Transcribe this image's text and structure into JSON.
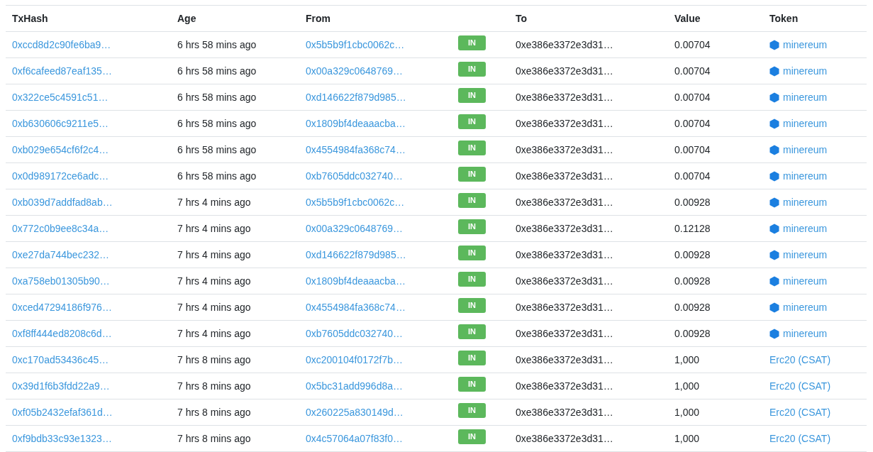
{
  "table": {
    "columns": [
      "TxHash",
      "Age",
      "From",
      "",
      "To",
      "Value",
      "Token"
    ],
    "rows": [
      {
        "txhash": "0xccd8d2c90fe6ba9…",
        "age": "6 hrs 58 mins ago",
        "from": "0x5b5b9f1cbc0062c…",
        "direction": "IN",
        "to": "0xe386e3372e3d31…",
        "value": "0.00704",
        "token": {
          "kind": "icon-link",
          "label": "minereum"
        }
      },
      {
        "txhash": "0xf6cafeed87eaf135…",
        "age": "6 hrs 58 mins ago",
        "from": "0x00a329c0648769…",
        "direction": "IN",
        "to": "0xe386e3372e3d31…",
        "value": "0.00704",
        "token": {
          "kind": "icon-link",
          "label": "minereum"
        }
      },
      {
        "txhash": "0x322ce5c4591c51…",
        "age": "6 hrs 58 mins ago",
        "from": "0xd146622f879d985…",
        "direction": "IN",
        "to": "0xe386e3372e3d31…",
        "value": "0.00704",
        "token": {
          "kind": "icon-link",
          "label": "minereum"
        }
      },
      {
        "txhash": "0xb630606c9211e5…",
        "age": "6 hrs 58 mins ago",
        "from": "0x1809bf4deaaacba…",
        "direction": "IN",
        "to": "0xe386e3372e3d31…",
        "value": "0.00704",
        "token": {
          "kind": "icon-link",
          "label": "minereum"
        }
      },
      {
        "txhash": "0xb029e654cf6f2c4…",
        "age": "6 hrs 58 mins ago",
        "from": "0x4554984fa368c74…",
        "direction": "IN",
        "to": "0xe386e3372e3d31…",
        "value": "0.00704",
        "token": {
          "kind": "icon-link",
          "label": "minereum"
        }
      },
      {
        "txhash": "0x0d989172ce6adc…",
        "age": "6 hrs 58 mins ago",
        "from": "0xb7605ddc032740…",
        "direction": "IN",
        "to": "0xe386e3372e3d31…",
        "value": "0.00704",
        "token": {
          "kind": "icon-link",
          "label": "minereum"
        }
      },
      {
        "txhash": "0xb039d7addfad8ab…",
        "age": "7 hrs 4 mins ago",
        "from": "0x5b5b9f1cbc0062c…",
        "direction": "IN",
        "to": "0xe386e3372e3d31…",
        "value": "0.00928",
        "token": {
          "kind": "icon-link",
          "label": "minereum"
        }
      },
      {
        "txhash": "0x772c0b9ee8c34a…",
        "age": "7 hrs 4 mins ago",
        "from": "0x00a329c0648769…",
        "direction": "IN",
        "to": "0xe386e3372e3d31…",
        "value": "0.12128",
        "token": {
          "kind": "icon-link",
          "label": "minereum"
        }
      },
      {
        "txhash": "0xe27da744bec232…",
        "age": "7 hrs 4 mins ago",
        "from": "0xd146622f879d985…",
        "direction": "IN",
        "to": "0xe386e3372e3d31…",
        "value": "0.00928",
        "token": {
          "kind": "icon-link",
          "label": "minereum"
        }
      },
      {
        "txhash": "0xa758eb01305b90…",
        "age": "7 hrs 4 mins ago",
        "from": "0x1809bf4deaaacba…",
        "direction": "IN",
        "to": "0xe386e3372e3d31…",
        "value": "0.00928",
        "token": {
          "kind": "icon-link",
          "label": "minereum"
        }
      },
      {
        "txhash": "0xced47294186f976…",
        "age": "7 hrs 4 mins ago",
        "from": "0x4554984fa368c74…",
        "direction": "IN",
        "to": "0xe386e3372e3d31…",
        "value": "0.00928",
        "token": {
          "kind": "icon-link",
          "label": "minereum"
        }
      },
      {
        "txhash": "0xf8ff444ed8208c6d…",
        "age": "7 hrs 4 mins ago",
        "from": "0xb7605ddc032740…",
        "direction": "IN",
        "to": "0xe386e3372e3d31…",
        "value": "0.00928",
        "token": {
          "kind": "icon-link",
          "label": "minereum"
        }
      },
      {
        "txhash": "0xc170ad53436c45…",
        "age": "7 hrs 8 mins ago",
        "from": "0xc200104f0172f7b…",
        "direction": "IN",
        "to": "0xe386e3372e3d31…",
        "value": "1,000",
        "token": {
          "kind": "link",
          "label": "Erc20 (CSAT)"
        }
      },
      {
        "txhash": "0x39d1f6b3fdd22a9…",
        "age": "7 hrs 8 mins ago",
        "from": "0x5bc31add996d8a…",
        "direction": "IN",
        "to": "0xe386e3372e3d31…",
        "value": "1,000",
        "token": {
          "kind": "link",
          "label": "Erc20 (CSAT)"
        }
      },
      {
        "txhash": "0xf05b2432efaf361d…",
        "age": "7 hrs 8 mins ago",
        "from": "0x260225a830149d…",
        "direction": "IN",
        "to": "0xe386e3372e3d31…",
        "value": "1,000",
        "token": {
          "kind": "link",
          "label": "Erc20 (CSAT)"
        }
      },
      {
        "txhash": "0xf9bdb33c93e1323…",
        "age": "7 hrs 8 mins ago",
        "from": "0x4c57064a07f83f0…",
        "direction": "IN",
        "to": "0xe386e3372e3d31…",
        "value": "1,000",
        "token": {
          "kind": "link",
          "label": "Erc20 (CSAT)"
        }
      }
    ]
  }
}
